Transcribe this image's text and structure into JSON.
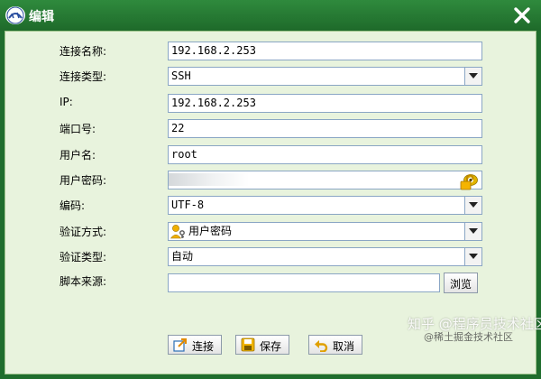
{
  "window": {
    "title": "编辑"
  },
  "form": {
    "connection_name": {
      "label": "连接名称:",
      "value": "192.168.2.253"
    },
    "connection_type": {
      "label": "连接类型:",
      "value": "SSH"
    },
    "ip": {
      "label": "IP:",
      "value": "192.168.2.253"
    },
    "port": {
      "label": "端口号:",
      "value": "22"
    },
    "username": {
      "label": "用户名:",
      "value": "root"
    },
    "password": {
      "label": "用户密码:",
      "value": ""
    },
    "encoding": {
      "label": "编码:",
      "value": "UTF-8"
    },
    "auth_method": {
      "label": "验证方式:",
      "value": "用户密码"
    },
    "verify_type": {
      "label": "验证类型:",
      "value": "自动"
    },
    "script_source": {
      "label": "脚本来源:",
      "value": "",
      "browse_label": "浏览"
    }
  },
  "buttons": {
    "connect": "连接",
    "save": "保存",
    "cancel": "取消"
  },
  "watermark": {
    "text": "知乎 @程序员技术社区",
    "text2": "@稀土掘金技术社区"
  },
  "colors": {
    "titlebar": "#1f6d2d",
    "client_bg": "#e8f3dd",
    "close_x": "#ffffff"
  },
  "icons": [
    "app-logo-icon",
    "close-icon",
    "dropdown-arrow-icon",
    "eye-icon",
    "unlock-icon",
    "user-key-icon",
    "connect-icon",
    "save-icon",
    "undo-icon"
  ]
}
